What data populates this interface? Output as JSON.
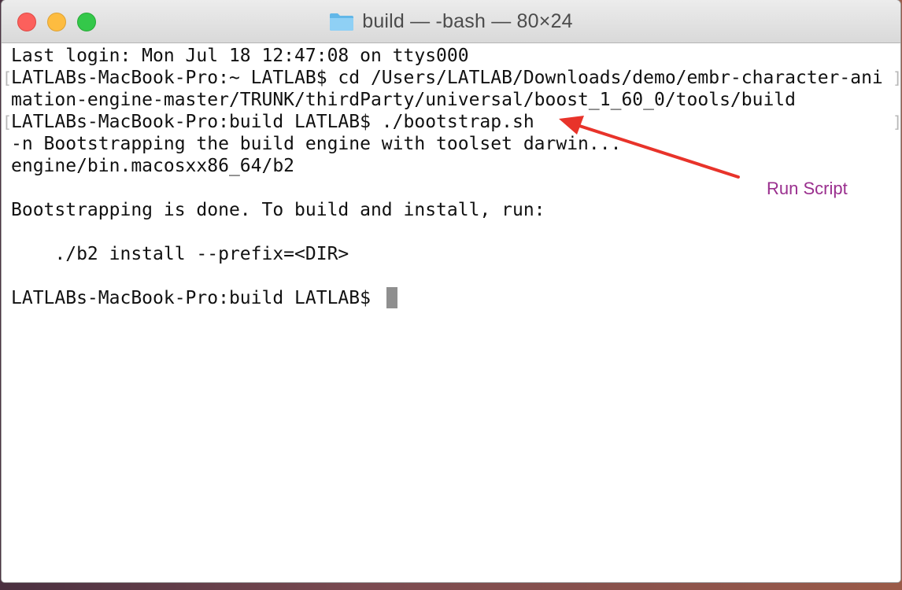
{
  "window": {
    "title": "build — -bash — 80×24",
    "controls": {
      "close": "close",
      "minimize": "minimize",
      "zoom": "zoom"
    },
    "folder_icon": "folder-icon"
  },
  "terminal": {
    "lines": [
      "Last login: Mon Jul 18 12:47:08 on ttys000",
      "LATLABs-MacBook-Pro:~ LATLAB$ cd /Users/LATLAB/Downloads/demo/embr-character-ani",
      "mation-engine-master/TRUNK/thirdParty/universal/boost_1_60_0/tools/build",
      "LATLABs-MacBook-Pro:build LATLAB$ ./bootstrap.sh",
      "-n Bootstrapping the build engine with toolset darwin...",
      "engine/bin.macosxx86_64/b2",
      "",
      "Bootstrapping is done. To build and install, run:",
      "",
      "    ./b2 install --prefix=<DIR>",
      "",
      "LATLABs-MacBook-Pro:build LATLAB$ "
    ],
    "text_color": "#111111",
    "cursor_color": "#8f8f8f"
  },
  "annotation": {
    "label": "Run Script",
    "label_color": "#9a2f8e",
    "arrow_color": "#e8332a"
  }
}
